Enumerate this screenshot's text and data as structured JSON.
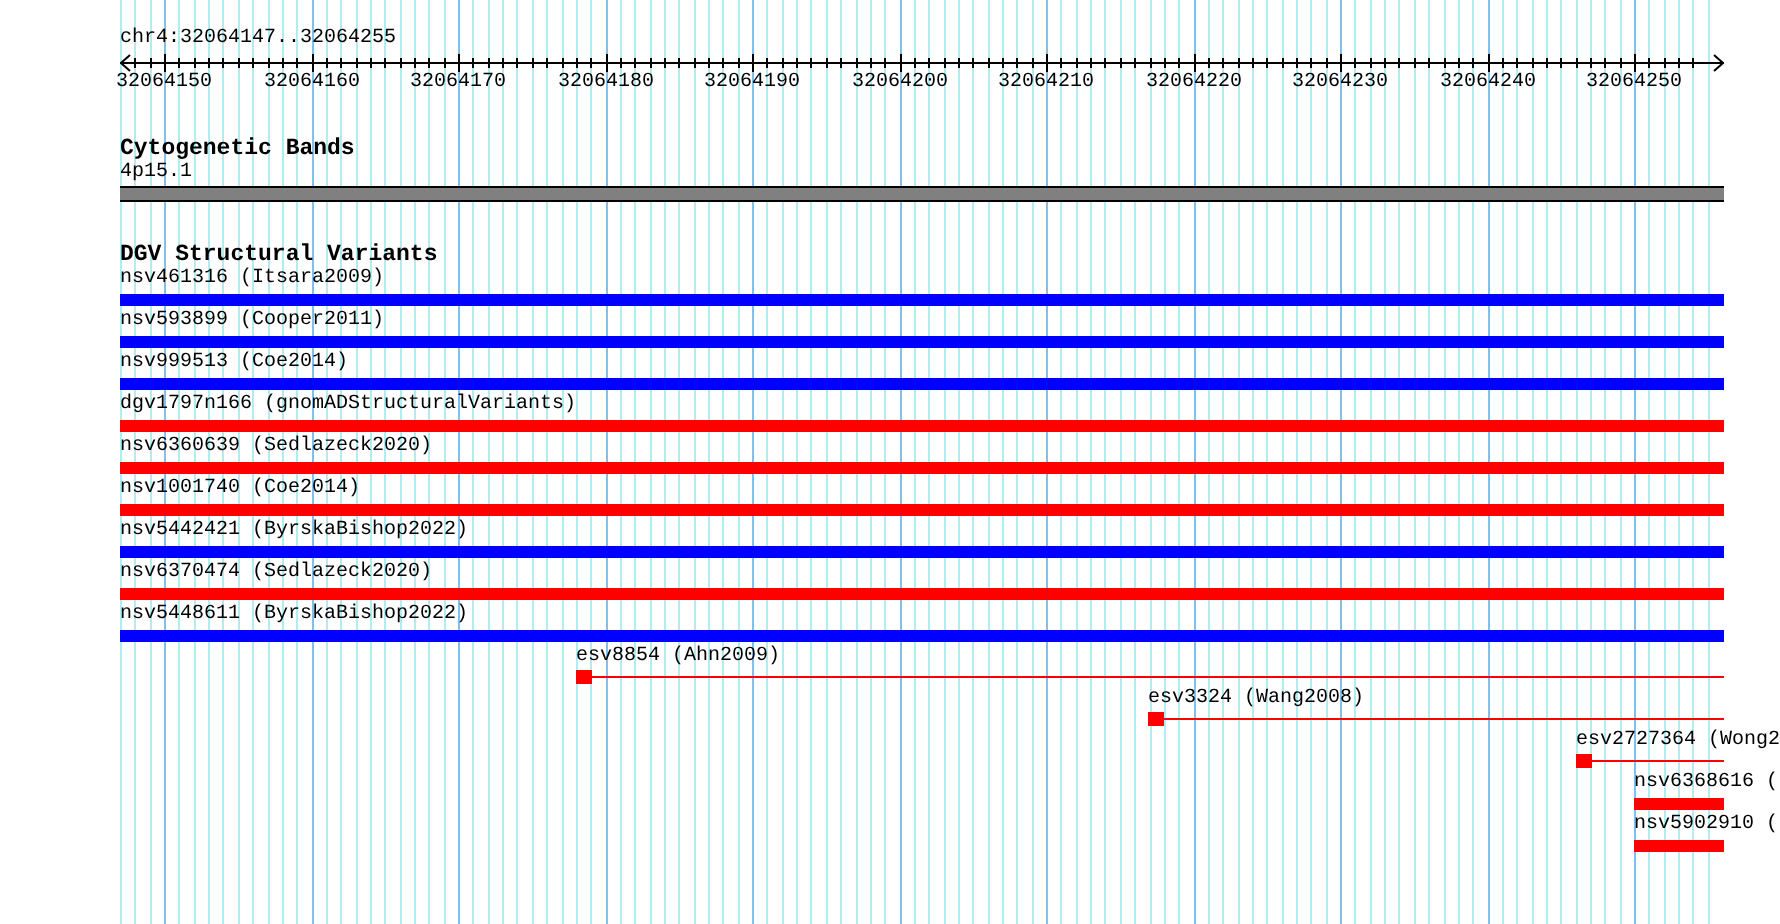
{
  "ruler": {
    "location": "chr4:32064147..32064255",
    "ticks": [
      "32064150",
      "32064160",
      "32064170",
      "32064180",
      "32064190",
      "32064200",
      "32064210",
      "32064220",
      "32064230",
      "32064240",
      "32064250"
    ]
  },
  "cytoband_track": {
    "title": "Cytogenetic Bands",
    "bands": [
      {
        "label": "4p15.1"
      }
    ]
  },
  "variant_track": {
    "title": "DGV Structural Variants",
    "features": [
      {
        "label": "nsv461316 (Itsara2009)",
        "kind": "bar",
        "color": "#0000ff"
      },
      {
        "label": "nsv593899 (Cooper2011)",
        "kind": "bar",
        "color": "#0000ff"
      },
      {
        "label": "nsv999513 (Coe2014)",
        "kind": "bar",
        "color": "#0000ff"
      },
      {
        "label": "dgv1797n166 (gnomADStructuralVariants)",
        "kind": "bar",
        "color": "#ff0000"
      },
      {
        "label": "nsv6360639 (Sedlazeck2020)",
        "kind": "bar",
        "color": "#ff0000"
      },
      {
        "label": "nsv1001740 (Coe2014)",
        "kind": "bar",
        "color": "#ff0000"
      },
      {
        "label": "nsv5442421 (ByrskaBishop2022)",
        "kind": "bar",
        "color": "#0000ff"
      },
      {
        "label": "nsv6370474 (Sedlazeck2020)",
        "kind": "bar",
        "color": "#ff0000"
      },
      {
        "label": "nsv5448611 (ByrskaBishop2022)",
        "kind": "bar",
        "color": "#0000ff"
      },
      {
        "label": "esv8854 (Ahn2009)",
        "kind": "line",
        "color": "#ff0000"
      },
      {
        "label": "esv3324 (Wang2008)",
        "kind": "line",
        "color": "#ff0000"
      },
      {
        "label": "esv2727364 (Wong2",
        "kind": "line",
        "color": "#ff0000"
      },
      {
        "label": "nsv6368616 (",
        "kind": "bar",
        "color": "#ff0000"
      },
      {
        "label": "nsv5902910 (",
        "kind": "bar",
        "color": "#ff0000"
      }
    ]
  }
}
